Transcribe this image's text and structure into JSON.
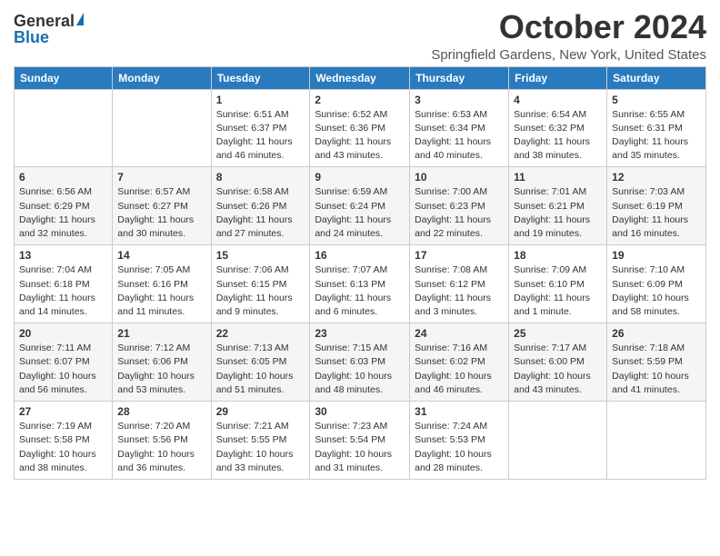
{
  "header": {
    "logo_general": "General",
    "logo_blue": "Blue",
    "month_title": "October 2024",
    "location": "Springfield Gardens, New York, United States"
  },
  "days_of_week": [
    "Sunday",
    "Monday",
    "Tuesday",
    "Wednesday",
    "Thursday",
    "Friday",
    "Saturday"
  ],
  "weeks": [
    [
      {
        "day": "",
        "content": ""
      },
      {
        "day": "",
        "content": ""
      },
      {
        "day": "1",
        "content": "Sunrise: 6:51 AM\nSunset: 6:37 PM\nDaylight: 11 hours and 46 minutes."
      },
      {
        "day": "2",
        "content": "Sunrise: 6:52 AM\nSunset: 6:36 PM\nDaylight: 11 hours and 43 minutes."
      },
      {
        "day": "3",
        "content": "Sunrise: 6:53 AM\nSunset: 6:34 PM\nDaylight: 11 hours and 40 minutes."
      },
      {
        "day": "4",
        "content": "Sunrise: 6:54 AM\nSunset: 6:32 PM\nDaylight: 11 hours and 38 minutes."
      },
      {
        "day": "5",
        "content": "Sunrise: 6:55 AM\nSunset: 6:31 PM\nDaylight: 11 hours and 35 minutes."
      }
    ],
    [
      {
        "day": "6",
        "content": "Sunrise: 6:56 AM\nSunset: 6:29 PM\nDaylight: 11 hours and 32 minutes."
      },
      {
        "day": "7",
        "content": "Sunrise: 6:57 AM\nSunset: 6:27 PM\nDaylight: 11 hours and 30 minutes."
      },
      {
        "day": "8",
        "content": "Sunrise: 6:58 AM\nSunset: 6:26 PM\nDaylight: 11 hours and 27 minutes."
      },
      {
        "day": "9",
        "content": "Sunrise: 6:59 AM\nSunset: 6:24 PM\nDaylight: 11 hours and 24 minutes."
      },
      {
        "day": "10",
        "content": "Sunrise: 7:00 AM\nSunset: 6:23 PM\nDaylight: 11 hours and 22 minutes."
      },
      {
        "day": "11",
        "content": "Sunrise: 7:01 AM\nSunset: 6:21 PM\nDaylight: 11 hours and 19 minutes."
      },
      {
        "day": "12",
        "content": "Sunrise: 7:03 AM\nSunset: 6:19 PM\nDaylight: 11 hours and 16 minutes."
      }
    ],
    [
      {
        "day": "13",
        "content": "Sunrise: 7:04 AM\nSunset: 6:18 PM\nDaylight: 11 hours and 14 minutes."
      },
      {
        "day": "14",
        "content": "Sunrise: 7:05 AM\nSunset: 6:16 PM\nDaylight: 11 hours and 11 minutes."
      },
      {
        "day": "15",
        "content": "Sunrise: 7:06 AM\nSunset: 6:15 PM\nDaylight: 11 hours and 9 minutes."
      },
      {
        "day": "16",
        "content": "Sunrise: 7:07 AM\nSunset: 6:13 PM\nDaylight: 11 hours and 6 minutes."
      },
      {
        "day": "17",
        "content": "Sunrise: 7:08 AM\nSunset: 6:12 PM\nDaylight: 11 hours and 3 minutes."
      },
      {
        "day": "18",
        "content": "Sunrise: 7:09 AM\nSunset: 6:10 PM\nDaylight: 11 hours and 1 minute."
      },
      {
        "day": "19",
        "content": "Sunrise: 7:10 AM\nSunset: 6:09 PM\nDaylight: 10 hours and 58 minutes."
      }
    ],
    [
      {
        "day": "20",
        "content": "Sunrise: 7:11 AM\nSunset: 6:07 PM\nDaylight: 10 hours and 56 minutes."
      },
      {
        "day": "21",
        "content": "Sunrise: 7:12 AM\nSunset: 6:06 PM\nDaylight: 10 hours and 53 minutes."
      },
      {
        "day": "22",
        "content": "Sunrise: 7:13 AM\nSunset: 6:05 PM\nDaylight: 10 hours and 51 minutes."
      },
      {
        "day": "23",
        "content": "Sunrise: 7:15 AM\nSunset: 6:03 PM\nDaylight: 10 hours and 48 minutes."
      },
      {
        "day": "24",
        "content": "Sunrise: 7:16 AM\nSunset: 6:02 PM\nDaylight: 10 hours and 46 minutes."
      },
      {
        "day": "25",
        "content": "Sunrise: 7:17 AM\nSunset: 6:00 PM\nDaylight: 10 hours and 43 minutes."
      },
      {
        "day": "26",
        "content": "Sunrise: 7:18 AM\nSunset: 5:59 PM\nDaylight: 10 hours and 41 minutes."
      }
    ],
    [
      {
        "day": "27",
        "content": "Sunrise: 7:19 AM\nSunset: 5:58 PM\nDaylight: 10 hours and 38 minutes."
      },
      {
        "day": "28",
        "content": "Sunrise: 7:20 AM\nSunset: 5:56 PM\nDaylight: 10 hours and 36 minutes."
      },
      {
        "day": "29",
        "content": "Sunrise: 7:21 AM\nSunset: 5:55 PM\nDaylight: 10 hours and 33 minutes."
      },
      {
        "day": "30",
        "content": "Sunrise: 7:23 AM\nSunset: 5:54 PM\nDaylight: 10 hours and 31 minutes."
      },
      {
        "day": "31",
        "content": "Sunrise: 7:24 AM\nSunset: 5:53 PM\nDaylight: 10 hours and 28 minutes."
      },
      {
        "day": "",
        "content": ""
      },
      {
        "day": "",
        "content": ""
      }
    ]
  ]
}
